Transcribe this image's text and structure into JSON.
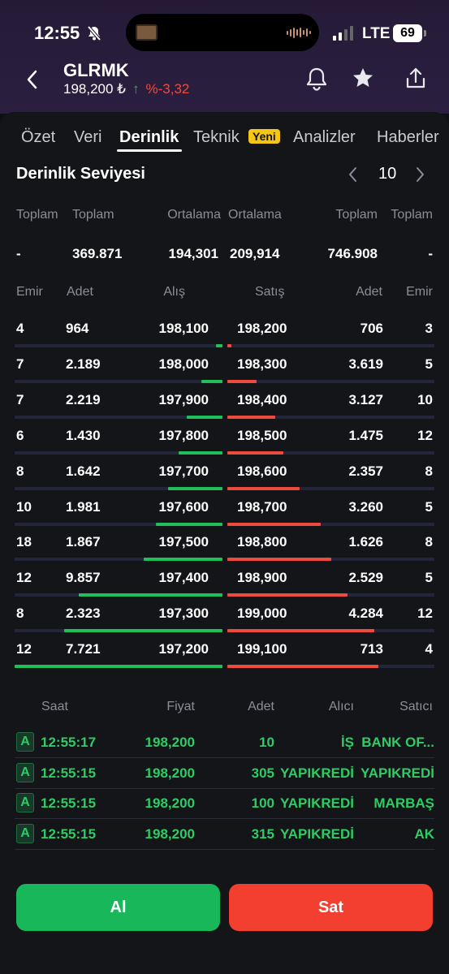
{
  "status_bar": {
    "time": "12:55",
    "network": "LTE",
    "battery": "69"
  },
  "header": {
    "symbol": "GLRMK",
    "price": "198,200 ₺",
    "arrow": "↑",
    "change": "%-3,32"
  },
  "tabs": [
    "Özet",
    "Veri",
    "Derinlik",
    "Teknik",
    "Analizler",
    "Haberler"
  ],
  "tab_badge": "Yeni",
  "depth": {
    "title": "Derinlik Seviyesi",
    "level": "10",
    "summary_headers": [
      "Toplam",
      "Toplam",
      "Ortalama",
      "Ortalama",
      "Toplam",
      "Toplam"
    ],
    "summary_values": [
      "-",
      "369.871",
      "194,301",
      "209,914",
      "746.908",
      "-"
    ],
    "col_headers": [
      "Emir",
      "Adet",
      "Alış",
      "Satış",
      "Adet",
      "Emir"
    ],
    "rows": [
      {
        "bid_orders": "4",
        "bid_qty": "964",
        "bid": "198,100",
        "ask": "198,200",
        "ask_qty": "706",
        "ask_orders": "3",
        "bid_frac": 0.03,
        "ask_frac": 0.02
      },
      {
        "bid_orders": "7",
        "bid_qty": "2.189",
        "bid": "198,000",
        "ask": "198,300",
        "ask_qty": "3.619",
        "ask_orders": "5",
        "bid_frac": 0.1,
        "ask_frac": 0.14
      },
      {
        "bid_orders": "7",
        "bid_qty": "2.219",
        "bid": "197,900",
        "ask": "198,400",
        "ask_qty": "3.127",
        "ask_orders": "10",
        "bid_frac": 0.17,
        "ask_frac": 0.23
      },
      {
        "bid_orders": "6",
        "bid_qty": "1.430",
        "bid": "197,800",
        "ask": "198,500",
        "ask_qty": "1.475",
        "ask_orders": "12",
        "bid_frac": 0.21,
        "ask_frac": 0.27
      },
      {
        "bid_orders": "8",
        "bid_qty": "1.642",
        "bid": "197,700",
        "ask": "198,600",
        "ask_qty": "2.357",
        "ask_orders": "8",
        "bid_frac": 0.26,
        "ask_frac": 0.35
      },
      {
        "bid_orders": "10",
        "bid_qty": "1.981",
        "bid": "197,600",
        "ask": "198,700",
        "ask_qty": "3.260",
        "ask_orders": "5",
        "bid_frac": 0.32,
        "ask_frac": 0.45
      },
      {
        "bid_orders": "18",
        "bid_qty": "1.867",
        "bid": "197,500",
        "ask": "198,800",
        "ask_qty": "1.626",
        "ask_orders": "8",
        "bid_frac": 0.38,
        "ask_frac": 0.5
      },
      {
        "bid_orders": "12",
        "bid_qty": "9.857",
        "bid": "197,400",
        "ask": "198,900",
        "ask_qty": "2.529",
        "ask_orders": "5",
        "bid_frac": 0.69,
        "ask_frac": 0.58
      },
      {
        "bid_orders": "8",
        "bid_qty": "2.323",
        "bid": "197,300",
        "ask": "199,000",
        "ask_qty": "4.284",
        "ask_orders": "12",
        "bid_frac": 0.76,
        "ask_frac": 0.71
      },
      {
        "bid_orders": "12",
        "bid_qty": "7.721",
        "bid": "197,200",
        "ask": "199,100",
        "ask_qty": "713",
        "ask_orders": "4",
        "bid_frac": 1.0,
        "ask_frac": 0.73
      }
    ]
  },
  "trades": {
    "headers": [
      "Saat",
      "Fiyat",
      "Adet",
      "Alıcı",
      "Satıcı"
    ],
    "rows": [
      {
        "side": "A",
        "time": "12:55:17",
        "price": "198,200",
        "qty": "10",
        "buyer": "İŞ",
        "seller": "BANK OF..."
      },
      {
        "side": "A",
        "time": "12:55:15",
        "price": "198,200",
        "qty": "305",
        "buyer": "YAPIKREDİ",
        "seller": "YAPIKREDİ"
      },
      {
        "side": "A",
        "time": "12:55:15",
        "price": "198,200",
        "qty": "100",
        "buyer": "YAPIKREDİ",
        "seller": "MARBAŞ"
      },
      {
        "side": "A",
        "time": "12:55:15",
        "price": "198,200",
        "qty": "315",
        "buyer": "YAPIKREDİ",
        "seller": "AK"
      }
    ]
  },
  "actions": {
    "buy": "Al",
    "sell": "Sat"
  },
  "colors": {
    "buy": "#18b85a",
    "sell": "#f23f30",
    "badge": "#f5c518"
  }
}
